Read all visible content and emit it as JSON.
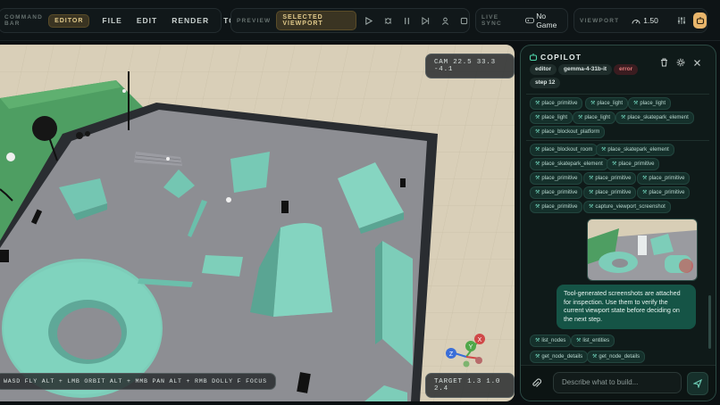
{
  "topbar": {
    "command_bar_label": "COMMAND BAR",
    "mode_pill": "EDITOR",
    "menus": [
      "FILE",
      "EDIT",
      "RENDER",
      "TOO"
    ],
    "preview_label": "PREVIEW",
    "preview_pill": "SELECTED VIEWPORT",
    "live_sync_label": "LIVE SYNC",
    "live_sync_value": "No Game",
    "viewport_label": "VIEWPORT",
    "viewport_value": "1.50"
  },
  "viewport": {
    "cam_readout": "CAM 22.5 33.3 -4.1",
    "controls_hint": "WASD FLY ALT + LMB ORBIT ALT + MMB PAN ALT + RMB DOLLY F FOCUS",
    "target_readout": "TARGET 1.3 1.0 2.4",
    "gizmo": {
      "x": "X",
      "y": "Y",
      "z": "Z"
    }
  },
  "copilot": {
    "title": "COPILOT",
    "badges": [
      "editor",
      "gemma-4-31b-it",
      "error",
      "step 12"
    ],
    "tools_group1": [
      "place_primitive",
      "place_light",
      "place_light",
      "place_light",
      "place_light",
      "place_skatepark_element",
      "place_blockout_platform"
    ],
    "tools_group2": [
      "place_blockout_room",
      "place_skatepark_element",
      "place_skatepark_element",
      "place_primitive",
      "place_primitive",
      "place_primitive",
      "place_primitive",
      "place_primitive",
      "place_primitive",
      "place_primitive",
      "place_primitive",
      "capture_viewport_screenshot"
    ],
    "message": "Tool-generated screenshots are attached for inspection. Use them to verify the current viewport state before deciding on the next step.",
    "tools_group3": [
      "list_nodes",
      "list_entities",
      "get_node_details",
      "get_node_details"
    ],
    "input_placeholder": "Describe what to build...",
    "colors": {
      "accent": "#155446",
      "panel": "#0f1a19",
      "error": "#e07a7a"
    }
  }
}
